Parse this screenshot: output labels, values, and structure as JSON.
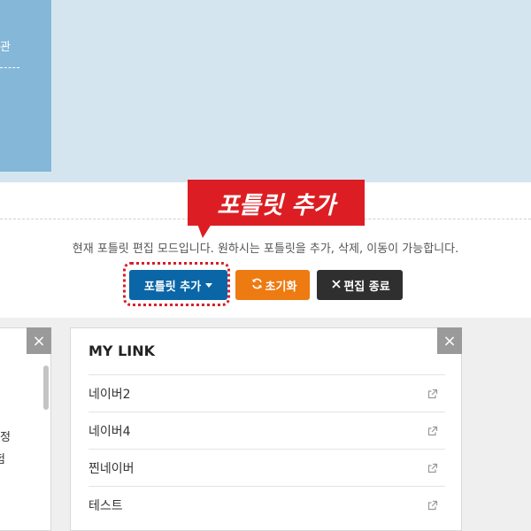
{
  "top_panel": {
    "label_fragment": "관"
  },
  "callout": {
    "text": "포틀릿 추가"
  },
  "edit_bar": {
    "notice": "현재 포틀릿 편집 모드입니다. 원하시는 포틀릿을 추가, 삭제, 이동이 가능합니다.",
    "add_button": "포틀릿 추가",
    "reset_button": "초기화",
    "close_button": "편집 종료"
  },
  "left_card": {
    "text_line1": "정",
    "text_line2": "험",
    "close_glyph": "×"
  },
  "mylink_card": {
    "title": "MY LINK",
    "close_glyph": "×",
    "links": [
      {
        "label": "네이버2",
        "icon": "external-link-icon"
      },
      {
        "label": "네이버4",
        "icon": "external-link-icon"
      },
      {
        "label": "찐네이버",
        "icon": "external-link-icon"
      },
      {
        "label": "테스트",
        "icon": "external-link-icon"
      }
    ]
  },
  "colors": {
    "callout": "#dc1e24",
    "add_button": "#0a66a6",
    "reset_button": "#ee7a12",
    "close_button": "#2f2f2f"
  }
}
